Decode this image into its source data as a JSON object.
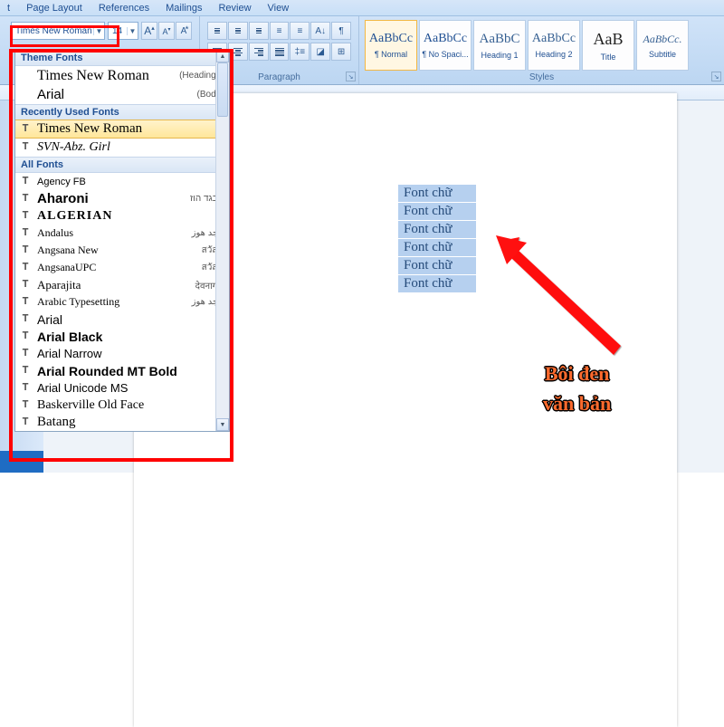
{
  "menu": {
    "t0": "t",
    "page_layout": "Page Layout",
    "references": "References",
    "mailings": "Mailings",
    "review": "Review",
    "view": "View"
  },
  "font": {
    "name": "Times New Roman",
    "size": "14",
    "grow": "A",
    "shrink": "A",
    "clear": "Aa"
  },
  "paragraph": {
    "label": "Paragraph"
  },
  "styles": {
    "label": "Styles",
    "items": [
      {
        "preview": "AaBbCc",
        "label": "¶ Normal"
      },
      {
        "preview": "AaBbCc",
        "label": "¶ No Spaci..."
      },
      {
        "preview": "AaBbC",
        "label": "Heading 1"
      },
      {
        "preview": "AaBbCc",
        "label": "Heading 2"
      },
      {
        "preview": "AaB",
        "label": "Title"
      },
      {
        "preview": "AaBbCc.",
        "label": "Subtitle"
      }
    ]
  },
  "dropdown": {
    "sec_theme": "Theme Fonts",
    "theme": [
      {
        "name": "Times New Roman",
        "tag": "(Headings)"
      },
      {
        "name": "Arial",
        "tag": "(Body)"
      }
    ],
    "sec_recent": "Recently Used Fonts",
    "recent": [
      {
        "name": "Times New Roman"
      },
      {
        "name": "SVN-Abz. Girl"
      }
    ],
    "sec_all": "All Fonts",
    "all": [
      {
        "name": "Agency FB",
        "sample": ""
      },
      {
        "name": "Aharoni",
        "sample": "אבגד הוז"
      },
      {
        "name": "ALGERIAN",
        "sample": ""
      },
      {
        "name": "Andalus",
        "sample": "أبجد هوز"
      },
      {
        "name": "Angsana New",
        "sample": "สวัสดี"
      },
      {
        "name": "AngsanaUPC",
        "sample": "สวัสดี"
      },
      {
        "name": "Aparajita",
        "sample": "देवनागरी"
      },
      {
        "name": "Arabic Typesetting",
        "sample": "أبجد هوز"
      },
      {
        "name": "Arial",
        "sample": ""
      },
      {
        "name": "Arial Black",
        "sample": ""
      },
      {
        "name": "Arial Narrow",
        "sample": ""
      },
      {
        "name": "Arial Rounded MT Bold",
        "sample": ""
      },
      {
        "name": "Arial Unicode MS",
        "sample": ""
      },
      {
        "name": "Baskerville Old Face",
        "sample": ""
      },
      {
        "name": "Batang",
        "sample": ""
      }
    ]
  },
  "selection": {
    "text": "Font chữ"
  },
  "annotation": {
    "line1": "Bôi đen",
    "line2": "văn bản"
  }
}
